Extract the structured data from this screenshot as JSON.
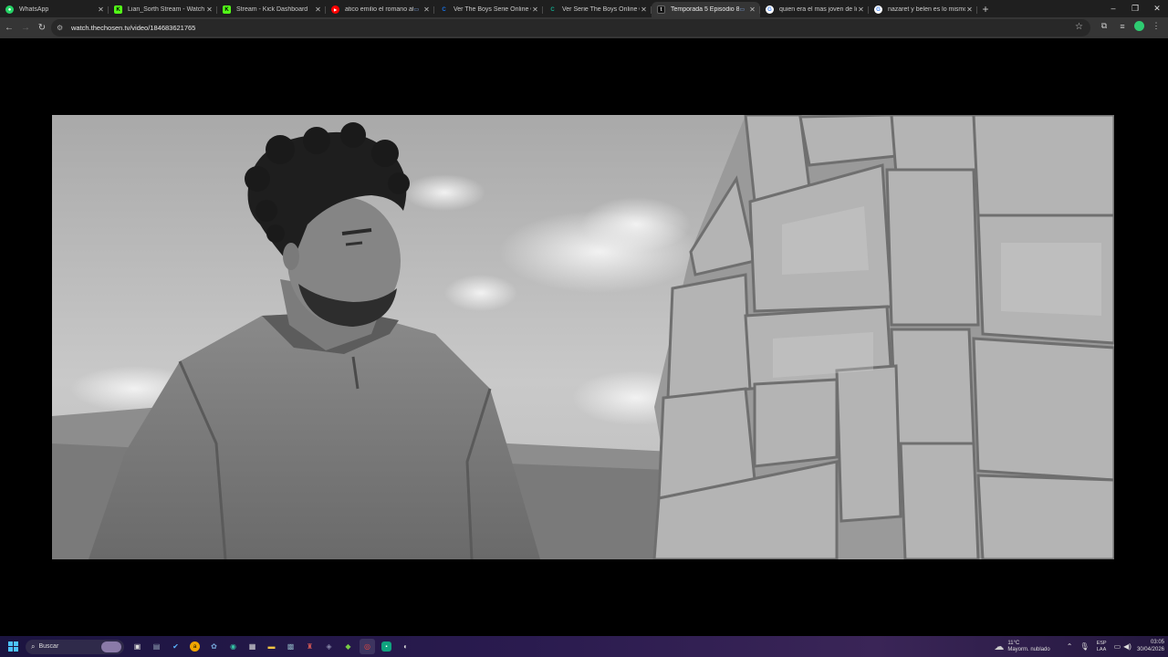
{
  "tabs": [
    {
      "title": "WhatsApp",
      "favicon": "whatsapp-icon",
      "color": "#25d366",
      "glyph": "●",
      "media": ""
    },
    {
      "title": "Lian_Sorth Stream - Watch Live",
      "favicon": "kick-icon",
      "color": "#53fc18",
      "glyph": "K",
      "media": ""
    },
    {
      "title": "Stream - Kick Dashboard",
      "favicon": "kick-icon",
      "color": "#53fc18",
      "glyph": "K",
      "media": ""
    },
    {
      "title": "atico emilio el romano atu",
      "favicon": "youtube-icon",
      "color": "#ff0000",
      "glyph": "▶",
      "media": "▭"
    },
    {
      "title": "Ver The Boys Serie Online Grati",
      "favicon": "c-site-icon",
      "color": "#1a73e8",
      "glyph": "C",
      "media": ""
    },
    {
      "title": "Ver Serie The Boys Online Grati",
      "favicon": "c-site-icon",
      "color": "#12a58a",
      "glyph": "C",
      "media": ""
    },
    {
      "title": "Temporada 5 Episodio 8: La",
      "favicon": "thechosen-icon",
      "color": "#444444",
      "glyph": "t",
      "media": "▭",
      "active": true
    },
    {
      "title": "quien era el mas joven de los a",
      "favicon": "google-icon",
      "color": "#4285f4",
      "glyph": "G",
      "media": ""
    },
    {
      "title": "nazaret y belen es lo mismo - B",
      "favicon": "google-icon",
      "color": "#4285f4",
      "glyph": "G",
      "media": ""
    }
  ],
  "toolbar": {
    "url": "watch.thechosen.tv/video/184683621765"
  },
  "taskbar": {
    "search_placeholder": "Buscar",
    "weather": {
      "temp": "11°C",
      "desc": "Mayorm. nublado"
    },
    "lang": {
      "top": "ESP",
      "bottom": "LAA"
    },
    "clock": {
      "time": "03:05",
      "date": "30/04/2026"
    }
  },
  "colors": {
    "tabstrip_bg": "#1f1f1f",
    "toolbar_bg": "#353535",
    "accent_profile": "#2ecc71"
  }
}
